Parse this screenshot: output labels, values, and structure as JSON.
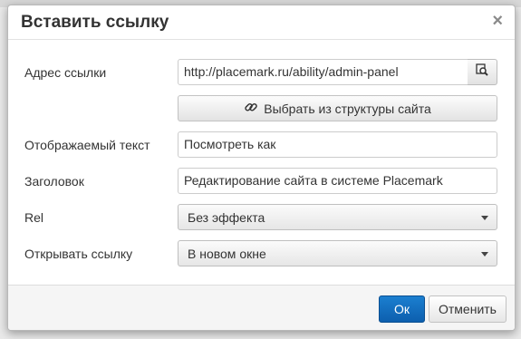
{
  "dialog": {
    "title": "Вставить ссылку",
    "close_glyph": "×"
  },
  "form": {
    "url_label": "Адрес ссылки",
    "url_value": "http://placemark.ru/ability/admin-panel",
    "browse_icon": "search-file-icon",
    "pick_label": "Выбрать из структуры сайта",
    "pick_icon": "link-icon",
    "text_label": "Отображаемый текст",
    "text_value": "Посмотреть как",
    "title_label": "Заголовок",
    "title_value": "Редактирование сайта в системе Placemark",
    "rel_label": "Rel",
    "rel_value": "Без эффекта",
    "target_label": "Открывать ссылку",
    "target_value": "В новом окне"
  },
  "footer": {
    "ok_label": "Ок",
    "cancel_label": "Отменить"
  },
  "colors": {
    "primary": "#1272c4",
    "text": "#333333",
    "border": "#cccccc"
  }
}
